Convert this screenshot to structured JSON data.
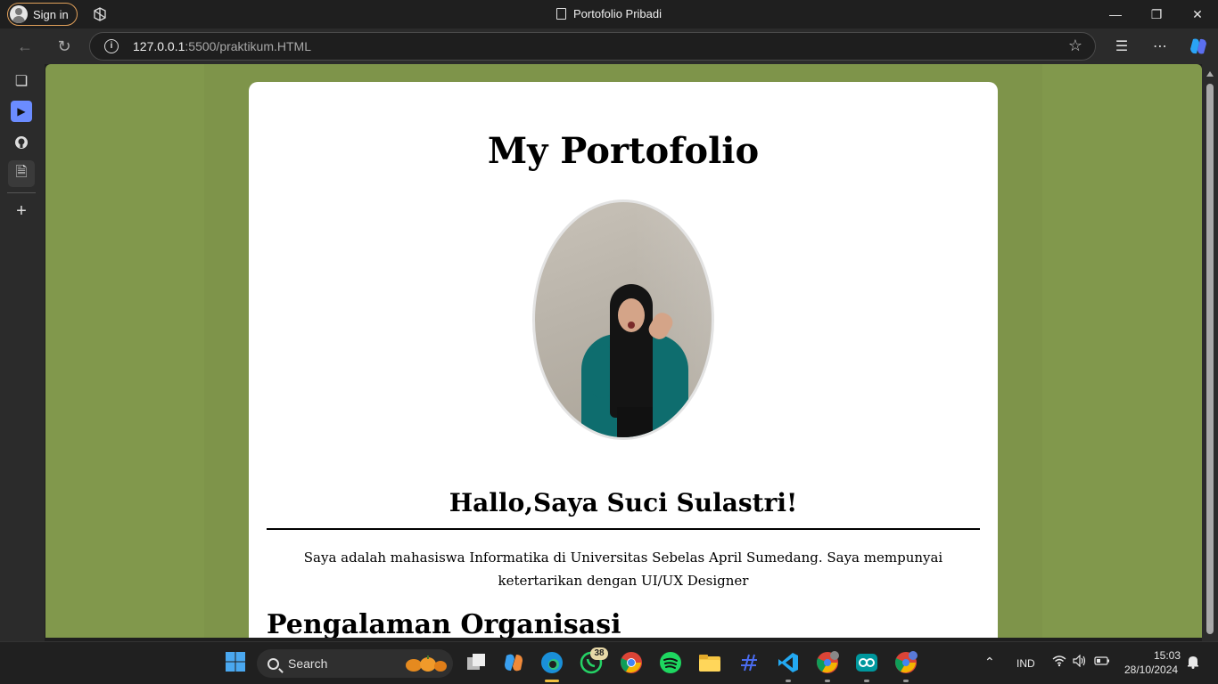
{
  "browser": {
    "sign_in_label": "Sign in",
    "window_title": "Portofolio Pribadi",
    "url_host": "127.0.0.1",
    "url_rest": ":5500/praktikum.HTML"
  },
  "page": {
    "title": "My Portofolio",
    "greeting": "Hallo,Saya Suci Sulastri!",
    "intro": "Saya adalah mahasiswa Informatika di Universitas Sebelas April Sumedang. Saya mempunyai ketertarikan dengan UI/UX Designer",
    "section_heading": "Pengalaman Organisasi",
    "colors": {
      "page_background": "#81984c",
      "card_background": "#ffffff"
    }
  },
  "taskbar": {
    "search_label": "Search",
    "whatsapp_badge": "38",
    "language": "IND",
    "time": "15:03",
    "date": "28/10/2024"
  }
}
